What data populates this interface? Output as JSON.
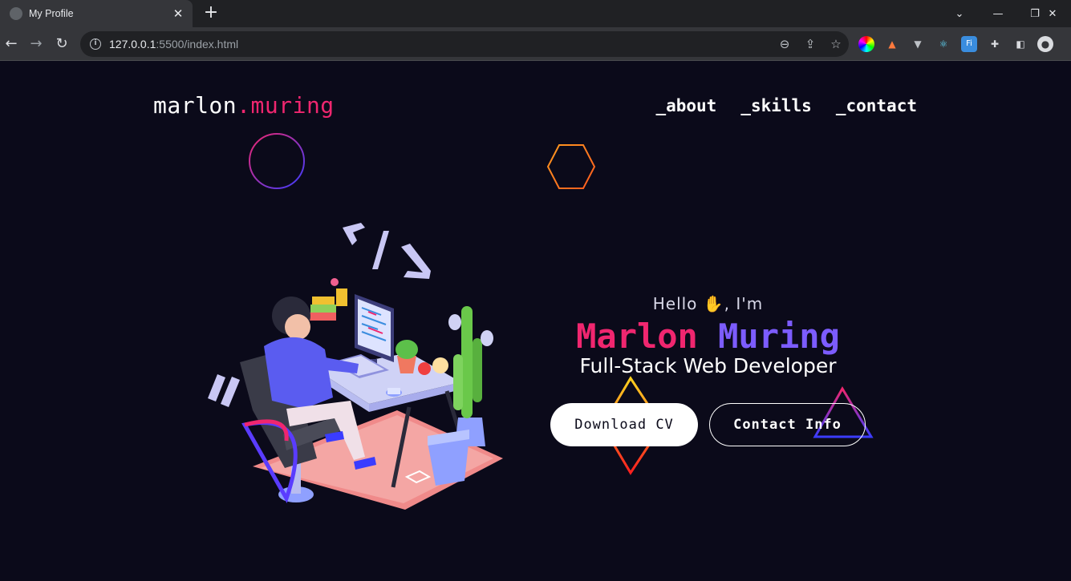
{
  "browser": {
    "tab_title": "My Profile",
    "url_host": "127.0.0.1",
    "url_path": ":5500/index.html"
  },
  "site": {
    "logo_main": "marlon",
    "logo_accent": ".muring",
    "nav": [
      "_about",
      "_skills",
      "_contact"
    ]
  },
  "hero": {
    "greeting": "Hello ✋, I'm",
    "first_name": "Marlon",
    "last_name": "Muring",
    "role": "Full-Stack Web Developer",
    "download_label": "Download CV",
    "contact_label": "Contact Info"
  },
  "colors": {
    "background": "#0b0a1a",
    "accent_pink": "#f0266f",
    "accent_purple": "#7c5cff"
  },
  "icons": {
    "tab_close": "close-icon",
    "new_tab": "plus-icon",
    "back": "arrow-left-icon",
    "forward": "arrow-right-icon",
    "reload": "reload-icon",
    "zoom": "zoom-icon",
    "share": "share-icon",
    "bookmark": "star-icon",
    "profile": "avatar-icon"
  }
}
